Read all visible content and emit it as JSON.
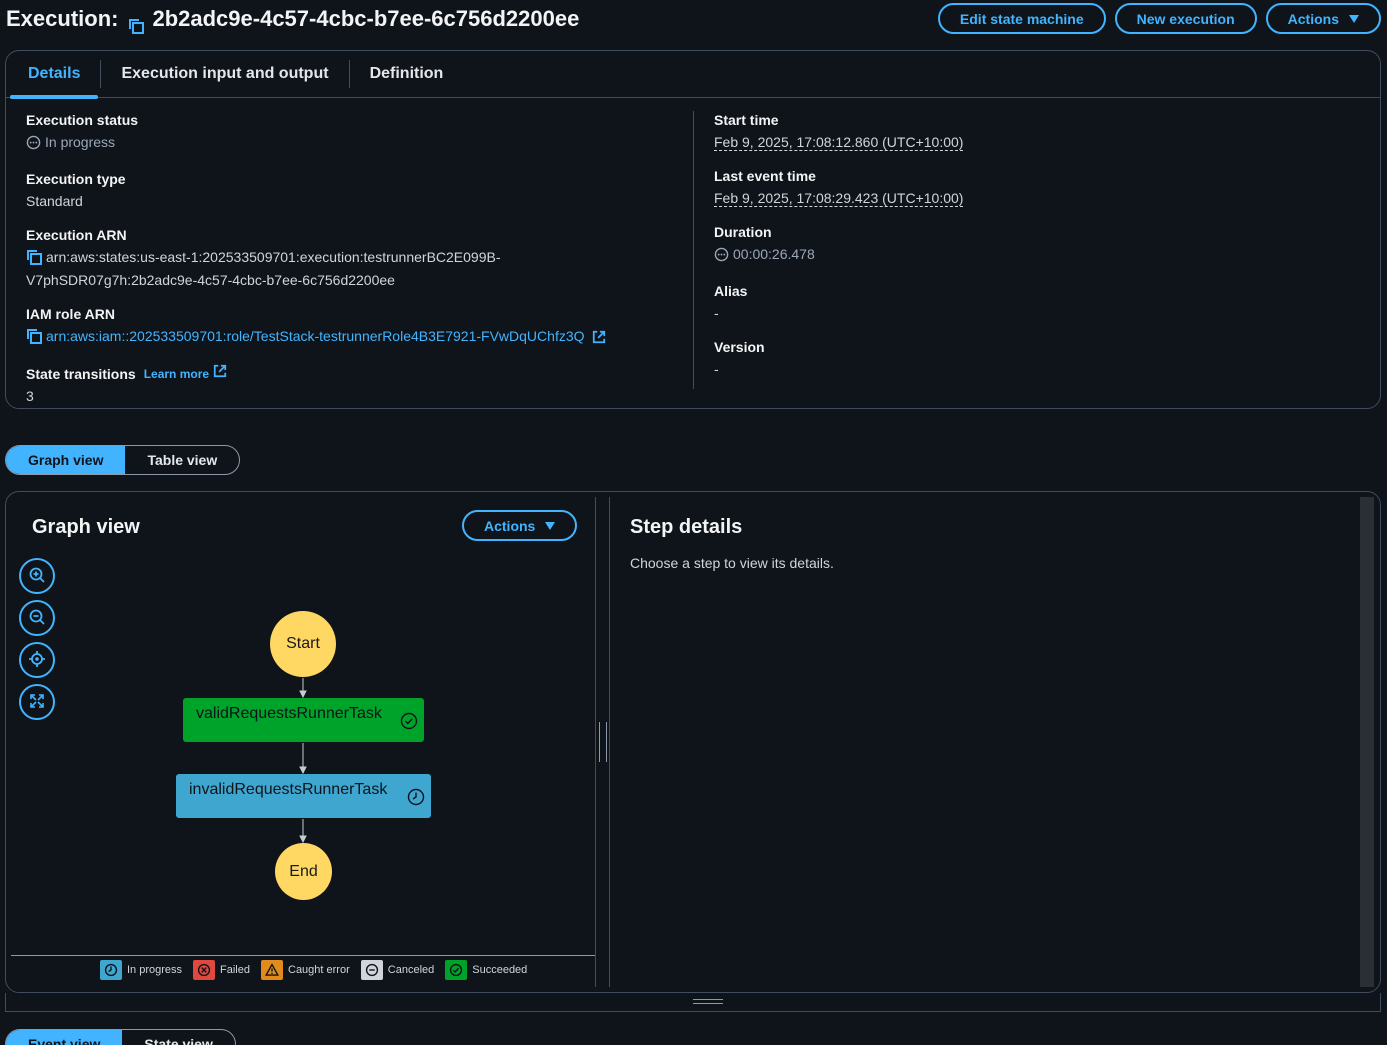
{
  "header": {
    "title_label": "Execution:",
    "execution_id": "2b2adc9e-4c57-4cbc-b7ee-6c756d2200ee",
    "buttons": {
      "edit_state_machine": "Edit state machine",
      "new_execution": "New execution",
      "actions": "Actions"
    }
  },
  "tabs": [
    "Details",
    "Execution input and output",
    "Definition"
  ],
  "details": {
    "execution_status": {
      "label": "Execution status",
      "value": "In progress"
    },
    "execution_type": {
      "label": "Execution type",
      "value": "Standard"
    },
    "execution_arn": {
      "label": "Execution ARN",
      "value_line1": "arn:aws:states:us-east-1:202533509701:execution:testrunnerBC2E099B-",
      "value_line2": "V7phSDR07g7h:2b2adc9e-4c57-4cbc-b7ee-6c756d2200ee"
    },
    "iam_role_arn": {
      "label": "IAM role ARN",
      "value": "arn:aws:iam::202533509701:role/TestStack-testrunnerRole4B3E7921-FVwDqUChfz3Q"
    },
    "state_transitions": {
      "label": "State transitions",
      "learn_more": "Learn more",
      "value": "3"
    },
    "start_time": {
      "label": "Start time",
      "value": "Feb 9, 2025, 17:08:12.860 (UTC+10:00)"
    },
    "last_event_time": {
      "label": "Last event time",
      "value": "Feb 9, 2025, 17:08:29.423 (UTC+10:00)"
    },
    "duration": {
      "label": "Duration",
      "value": "00:00:26.478"
    },
    "alias": {
      "label": "Alias",
      "value": "-"
    },
    "version": {
      "label": "Version",
      "value": "-"
    }
  },
  "view_toggle": {
    "graph": "Graph view",
    "table": "Table view"
  },
  "graph": {
    "title": "Graph view",
    "actions": "Actions",
    "nodes": {
      "start": "Start",
      "valid": "validRequestsRunnerTask",
      "invalid": "invalidRequestsRunnerTask",
      "end": "End"
    },
    "legend": [
      "In progress",
      "Failed",
      "Caught error",
      "Canceled",
      "Succeeded"
    ]
  },
  "step_details": {
    "title": "Step details",
    "description": "Choose a step to view its details."
  },
  "bottom_toggle": {
    "event": "Event view",
    "state": "State view"
  },
  "colors": {
    "accent": "#42b4ff",
    "succeeded": "#00a32a",
    "in_progress": "#3ea6cf",
    "start_end": "#ffd863",
    "failed": "#e0483e",
    "caught_error": "#e08b1b",
    "canceled": "#d1d5db"
  }
}
